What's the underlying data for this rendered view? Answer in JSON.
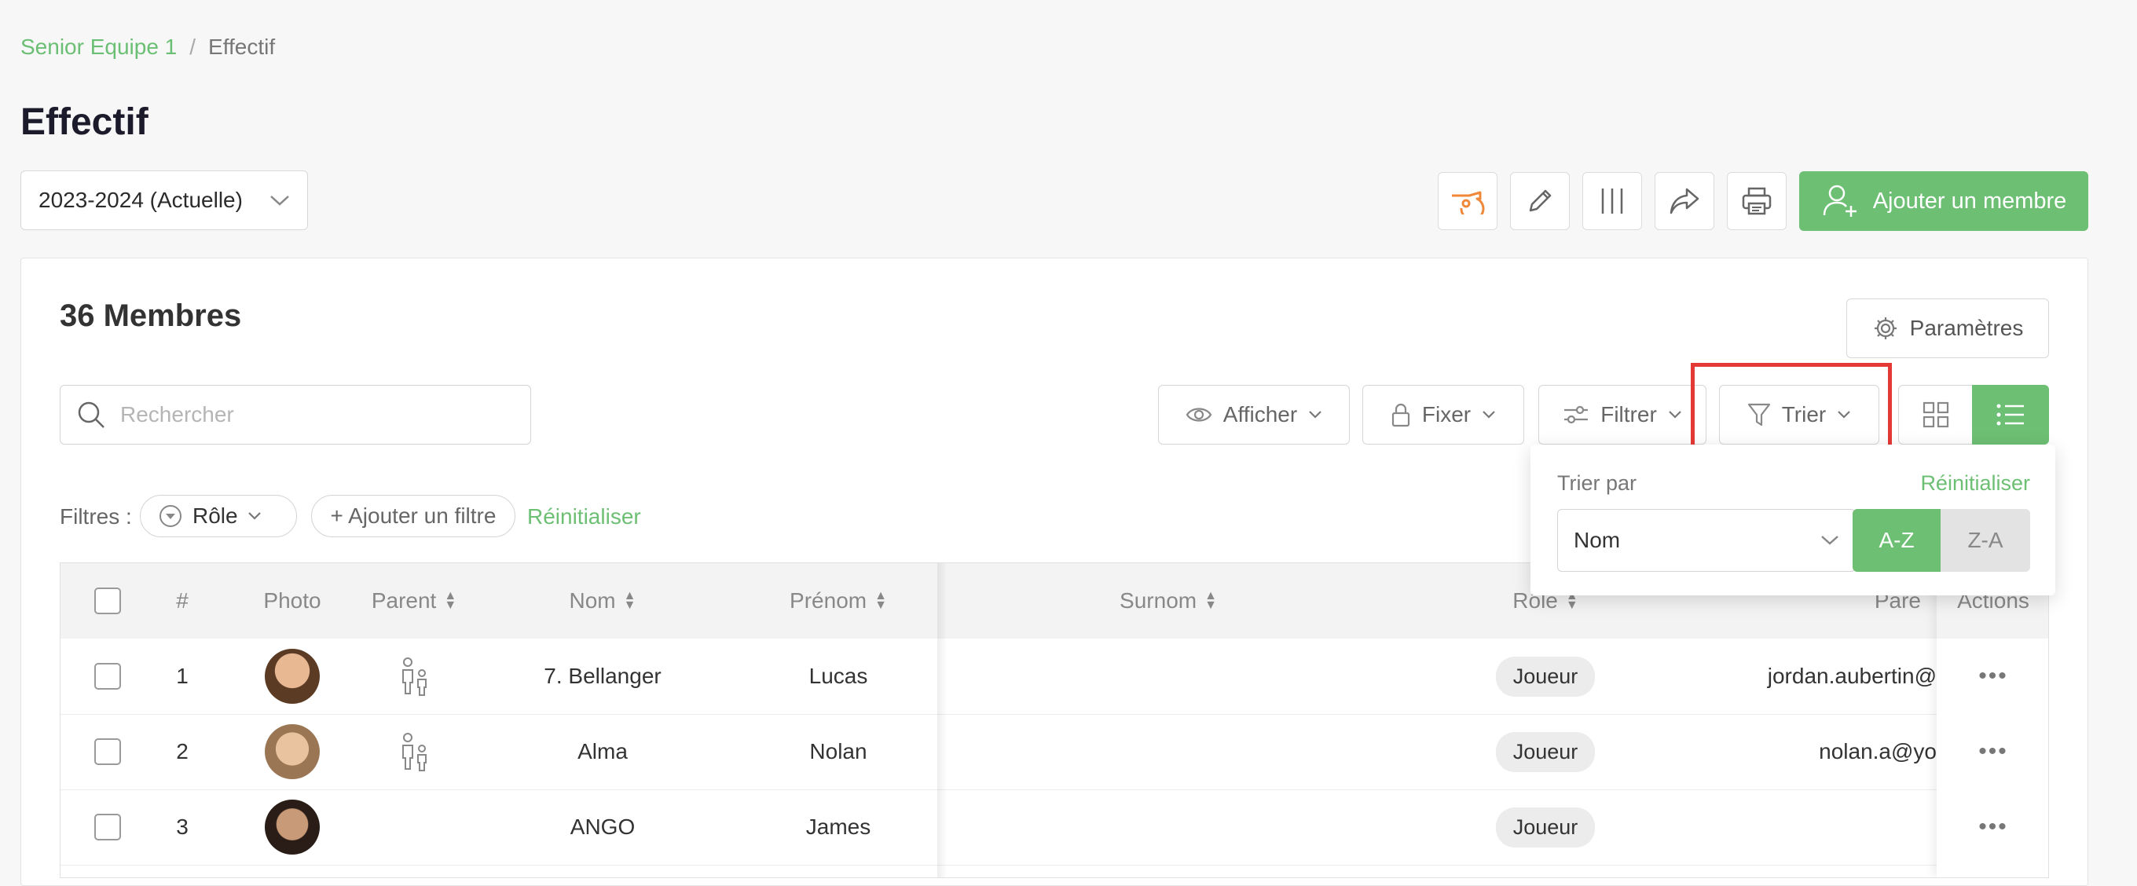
{
  "breadcrumb": {
    "team": "Senior Equipe 1",
    "separator": "/",
    "current": "Effectif"
  },
  "page_title": "Effectif",
  "season_select": {
    "value": "2023-2024 (Actuelle)"
  },
  "toolbar": {
    "add_member_label": "Ajouter un membre",
    "accent_color": "#6dbf74",
    "whistle_color": "#f0883a"
  },
  "members_title": "36 Membres",
  "params_label": "Paramètres",
  "search": {
    "placeholder": "Rechercher",
    "value": ""
  },
  "controls": {
    "afficher": "Afficher",
    "fixer": "Fixer",
    "filtrer": "Filtrer",
    "trier": "Trier"
  },
  "filters": {
    "label": "Filtres :",
    "role_chip": "Rôle",
    "add_filter": "+ Ajouter un filtre",
    "reset": "Réinitialiser"
  },
  "table": {
    "headers": {
      "index": "#",
      "photo": "Photo",
      "parent": "Parent",
      "nom": "Nom",
      "prenom": "Prénom",
      "surnom": "Surnom",
      "role": "Rôle",
      "parent_email": "Pare",
      "actions": "Actions"
    },
    "rows": [
      {
        "index": "1",
        "nom": "7. Bellanger",
        "prenom": "Lucas",
        "role": "Joueur",
        "email": "jordan.aubertin@",
        "has_parent": true,
        "actions": "•••"
      },
      {
        "index": "2",
        "nom": "Alma",
        "prenom": "Nolan",
        "role": "Joueur",
        "email": "nolan.a@yo",
        "has_parent": true,
        "actions": "•••"
      },
      {
        "index": "3",
        "nom": "ANGO",
        "prenom": "James",
        "role": "Joueur",
        "email": "",
        "has_parent": false,
        "actions": "•••"
      }
    ]
  },
  "sort_panel": {
    "label": "Trier par",
    "reset": "Réinitialiser",
    "field": "Nom",
    "asc": "A-Z",
    "desc": "Z-A"
  }
}
